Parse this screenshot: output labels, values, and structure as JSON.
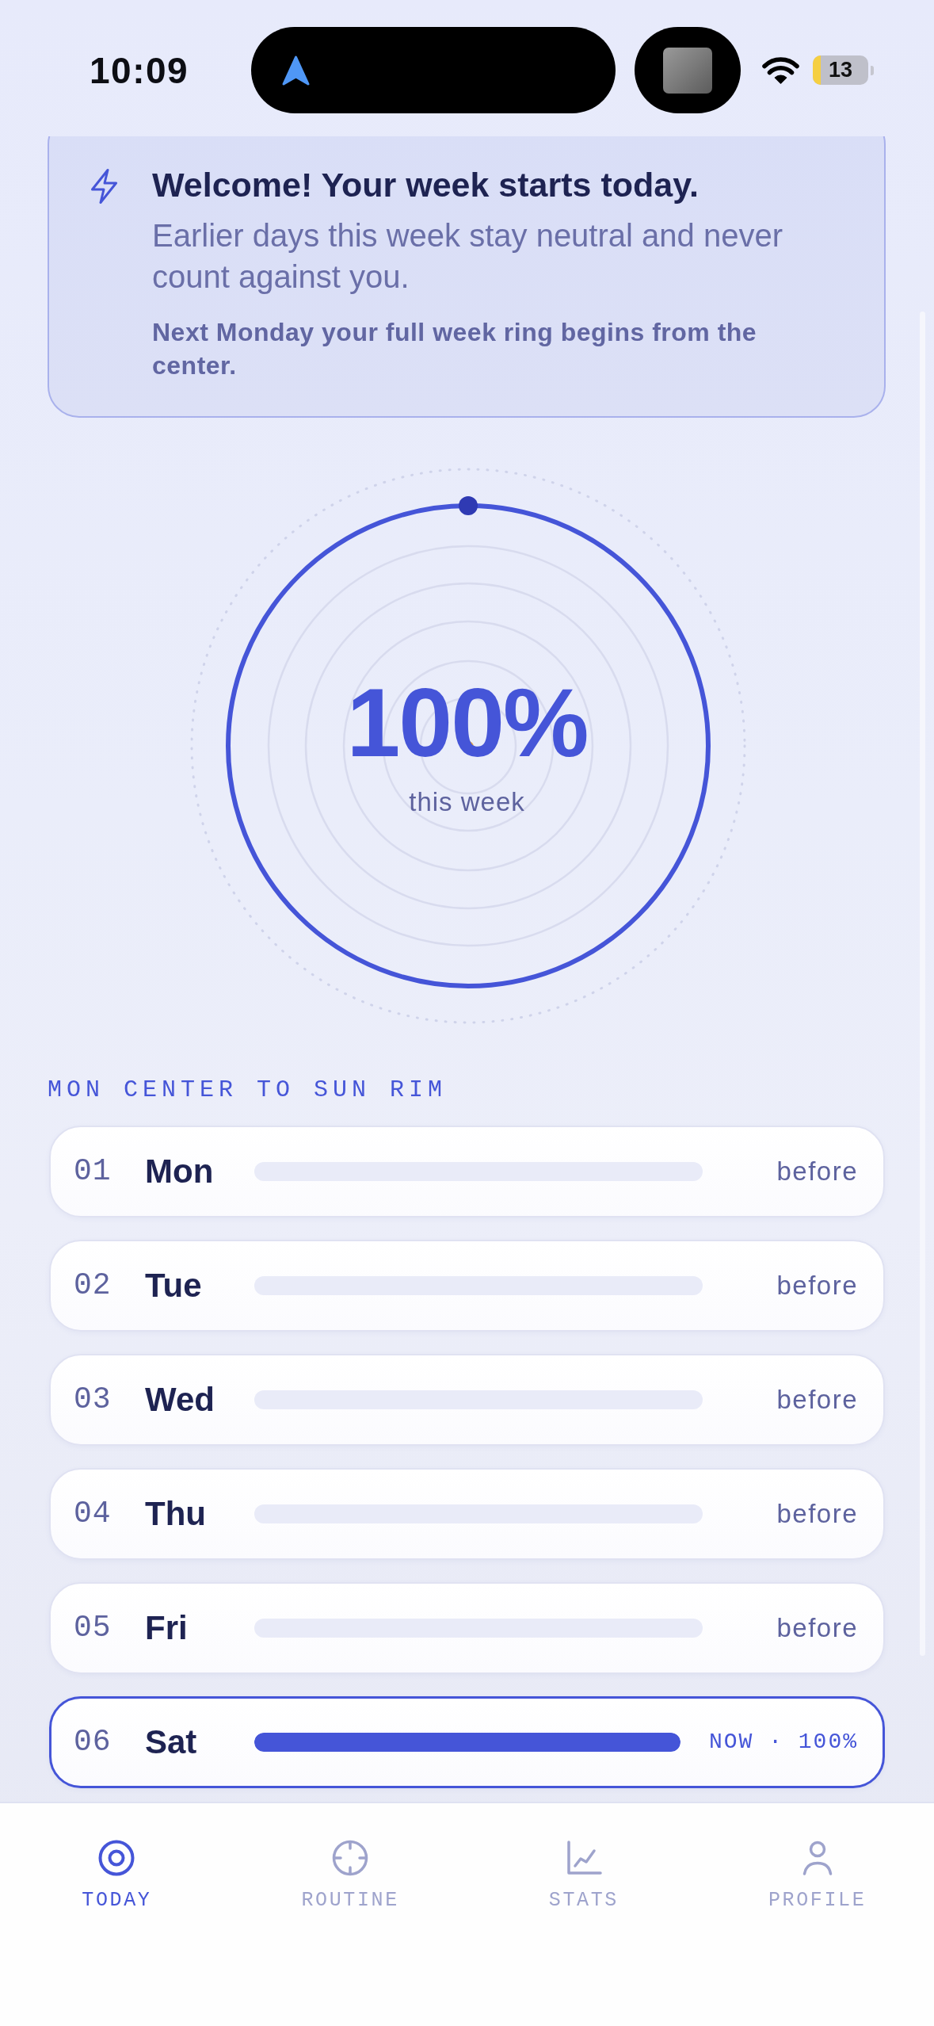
{
  "status_bar": {
    "time": "10:09",
    "battery": "13"
  },
  "welcome": {
    "title": "Welcome! Your week starts today.",
    "message": "Earlier days this week stay neutral and never count against you.",
    "note": "Next Monday your full week ring begins from the center."
  },
  "week_ring": {
    "level": 1,
    "value": "100%",
    "caption": "this week"
  },
  "section_label": "MON CENTER TO SUN RIM",
  "days": [
    {
      "number": "01",
      "name": "Mon",
      "status": "before",
      "current": false
    },
    {
      "number": "02",
      "name": "Tue",
      "status": "before",
      "current": false
    },
    {
      "number": "03",
      "name": "Wed",
      "status": "before",
      "current": false
    },
    {
      "number": "04",
      "name": "Thu",
      "status": "before",
      "current": false
    },
    {
      "number": "05",
      "name": "Fri",
      "status": "before",
      "current": false
    },
    {
      "number": "06",
      "name": "Sat",
      "level": 1,
      "status": "NOW · 100%",
      "current": true
    }
  ],
  "tabs": [
    {
      "label": "TODAY",
      "selected": true
    },
    {
      "label": "ROUTINE",
      "selected": false
    },
    {
      "label": "STATS",
      "selected": false
    },
    {
      "label": "PROFILE",
      "selected": false
    }
  ]
}
